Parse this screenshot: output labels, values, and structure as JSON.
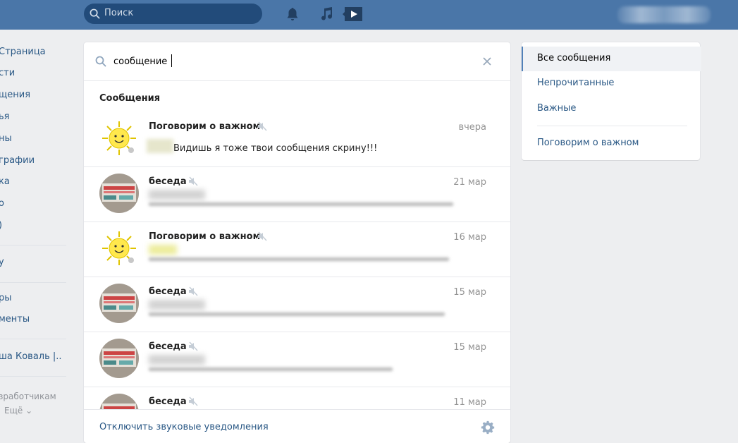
{
  "header": {
    "search_placeholder": "Поиск",
    "bell_icon": "bell-icon",
    "music_icon": "music-note-icon",
    "video_icon": "video-play-icon",
    "user_name_blurred": true
  },
  "leftnav": {
    "items": [
      "Страница",
      "сти",
      "щения",
      "ья",
      "ны",
      "графии",
      "ка",
      "о",
      "у",
      "ры",
      "менты",
      "ша Коваль |.."
    ],
    "footer": [
      "зработчикам",
      "Ещё ⌄"
    ]
  },
  "messages": {
    "search_query": "сообщение",
    "section_title": "Сообщения",
    "rows": [
      {
        "name": "Поговорим о важном",
        "date": "вчера",
        "text": "Видишь я тоже твои сообщения скрину!!!"
      },
      {
        "name": "беседа",
        "date": "21 мар"
      },
      {
        "name": "Поговорим о важном",
        "date": "16 мар"
      },
      {
        "name": "беседа",
        "date": "15 мар"
      },
      {
        "name": "беседа",
        "date": "15 мар"
      },
      {
        "name": "беседа",
        "date": "11 мар"
      }
    ],
    "footer_link": "Отключить звуковые уведомления"
  },
  "filters": {
    "items": [
      "Все сообщения",
      "Непрочитанные",
      "Важные"
    ],
    "folder": "Поговорим о важном",
    "active_index": 0
  },
  "colors": {
    "header_bg": "#4a76a8",
    "link": "#2a5885",
    "page_bg": "#edeef0"
  }
}
